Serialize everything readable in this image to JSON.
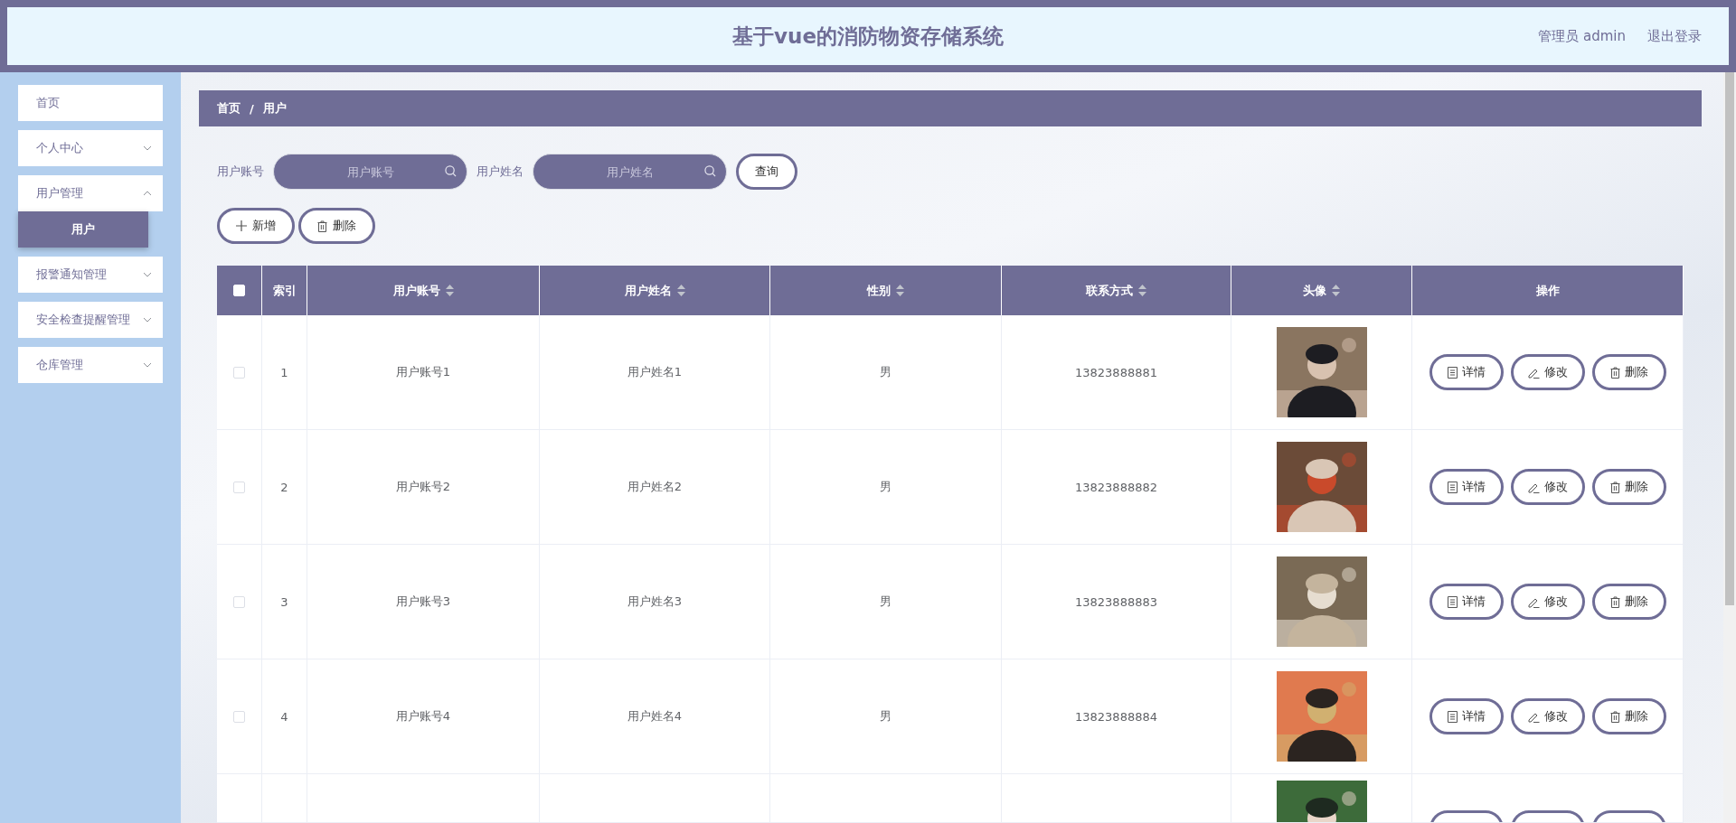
{
  "header": {
    "title": "基于vue的消防物资存储系统",
    "user": "管理员 admin",
    "logout": "退出登录"
  },
  "sidebar": {
    "items": [
      {
        "label": "首页",
        "expandable": false
      },
      {
        "label": "个人中心",
        "expandable": true,
        "expanded": false
      },
      {
        "label": "用户管理",
        "expandable": true,
        "expanded": true,
        "children": [
          {
            "label": "用户",
            "selected": true
          }
        ]
      },
      {
        "label": "报警通知管理",
        "expandable": true,
        "expanded": false
      },
      {
        "label": "安全检查提醒管理",
        "expandable": true,
        "expanded": false
      },
      {
        "label": "仓库管理",
        "expandable": true,
        "expanded": false
      }
    ]
  },
  "breadcrumb": [
    "首页",
    "/",
    "用户"
  ],
  "search": {
    "fields": [
      {
        "label": "用户账号",
        "placeholder": "用户账号"
      },
      {
        "label": "用户姓名",
        "placeholder": "用户姓名"
      }
    ],
    "button": "查询"
  },
  "toolbar": [
    {
      "kind": "add",
      "label": "新增"
    },
    {
      "kind": "delete",
      "label": "删除"
    }
  ],
  "table": {
    "columns": [
      {
        "label": "索引",
        "sortable": false
      },
      {
        "label": "用户账号",
        "sortable": true
      },
      {
        "label": "用户姓名",
        "sortable": true
      },
      {
        "label": "性别",
        "sortable": true
      },
      {
        "label": "联系方式",
        "sortable": true
      },
      {
        "label": "头像",
        "sortable": true
      },
      {
        "label": "操作",
        "sortable": false
      }
    ],
    "header_checked": false,
    "rows": [
      {
        "checked": false,
        "index": "1",
        "account": "用户账号1",
        "name": "用户姓名1",
        "gender": "男",
        "phone": "13823888881",
        "actions": [
          {
            "kind": "detail",
            "label": "详情"
          },
          {
            "kind": "edit",
            "label": "修改"
          },
          {
            "kind": "delete",
            "label": "删除"
          }
        ]
      },
      {
        "checked": false,
        "index": "2",
        "account": "用户账号2",
        "name": "用户姓名2",
        "gender": "男",
        "phone": "13823888882",
        "actions": [
          {
            "kind": "detail",
            "label": "详情"
          },
          {
            "kind": "edit",
            "label": "修改"
          },
          {
            "kind": "delete",
            "label": "删除"
          }
        ]
      },
      {
        "checked": false,
        "index": "3",
        "account": "用户账号3",
        "name": "用户姓名3",
        "gender": "男",
        "phone": "13823888883",
        "actions": [
          {
            "kind": "detail",
            "label": "详情"
          },
          {
            "kind": "edit",
            "label": "修改"
          },
          {
            "kind": "delete",
            "label": "删除"
          }
        ]
      },
      {
        "checked": false,
        "index": "4",
        "account": "用户账号4",
        "name": "用户姓名4",
        "gender": "男",
        "phone": "13823888884",
        "actions": [
          {
            "kind": "detail",
            "label": "详情"
          },
          {
            "kind": "edit",
            "label": "修改"
          },
          {
            "kind": "delete",
            "label": "删除"
          }
        ]
      },
      {
        "kind": "partial",
        "actions": [
          {
            "kind": "detail"
          },
          {
            "kind": "edit"
          },
          {
            "kind": "delete"
          }
        ]
      }
    ]
  }
}
